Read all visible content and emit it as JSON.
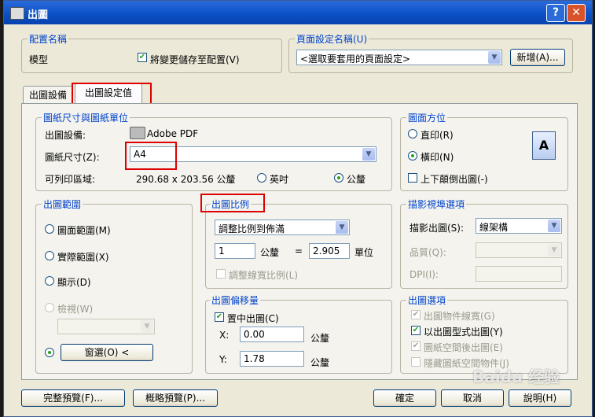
{
  "window": {
    "title": "出圖"
  },
  "config": {
    "group": "配置名稱",
    "name": "模型",
    "save_label": "將變更儲存至配置(V)"
  },
  "page_setup": {
    "group": "頁面設定名稱(U)",
    "selected": "<選取要套用的頁面設定>",
    "add_label": "新增(A)..."
  },
  "tabs": {
    "device": "出圖設備",
    "settings": "出圖設定值"
  },
  "paper": {
    "group": "圖紙尺寸與圖紙單位",
    "device_label": "出圖設備:",
    "device_value": "Adobe PDF",
    "size_label": "圖紙尺寸(Z):",
    "size_value": "A4",
    "printable_label": "可列印區域:",
    "printable_value": "290.68 x 203.56 公釐",
    "unit_inch": "英吋",
    "unit_mm": "公釐"
  },
  "orientation": {
    "group": "圖面方位",
    "portrait": "直印(R)",
    "landscape": "橫印(N)",
    "upside_down": "上下顛倒出圖(-)"
  },
  "area": {
    "group": "出圖範圍",
    "limits": "圖面範圍(M)",
    "extents": "實際範圍(X)",
    "display": "顯示(D)",
    "view": "檢視(W)",
    "window": "窗選(O) <"
  },
  "scale": {
    "group": "出圖比例",
    "mode": "調整比例到佈滿",
    "value1": "1",
    "unit1": "公釐",
    "equals": "=",
    "value2": "2.905",
    "unit2": "單位",
    "lineweights": "調整線寬比例(L)"
  },
  "offset": {
    "group": "出圖偏移量",
    "center": "置中出圖(C)",
    "x_label": "X:",
    "x_value": "0.00",
    "x_unit": "公釐",
    "y_label": "Y:",
    "y_value": "1.78",
    "y_unit": "公釐"
  },
  "shaded": {
    "group": "描影視埠選項",
    "shade_label": "描影出圖(S):",
    "shade_value": "線架構",
    "quality_label": "品質(Q):",
    "dpi_label": "DPI(I):"
  },
  "options": {
    "group": "出圖選項",
    "o1": "出圖物件線寬(G)",
    "o2": "以出圖型式出圖(Y)",
    "o3": "圖紙空間後出圖(E)",
    "o4": "隱藏圖紙空間物件(J)"
  },
  "footer": {
    "full_preview": "完整預覽(F)...",
    "partial_preview": "概略預覽(P)...",
    "ok": "確定",
    "cancel": "取消",
    "help": "說明(H)"
  },
  "watermark": "Baidu 经验",
  "colors": {
    "title_bar": "#0a4fc4",
    "dialog_bg": "#ece9d8",
    "group_label": "#0044cc",
    "highlight": "#dd0000",
    "check": "#21a121"
  }
}
